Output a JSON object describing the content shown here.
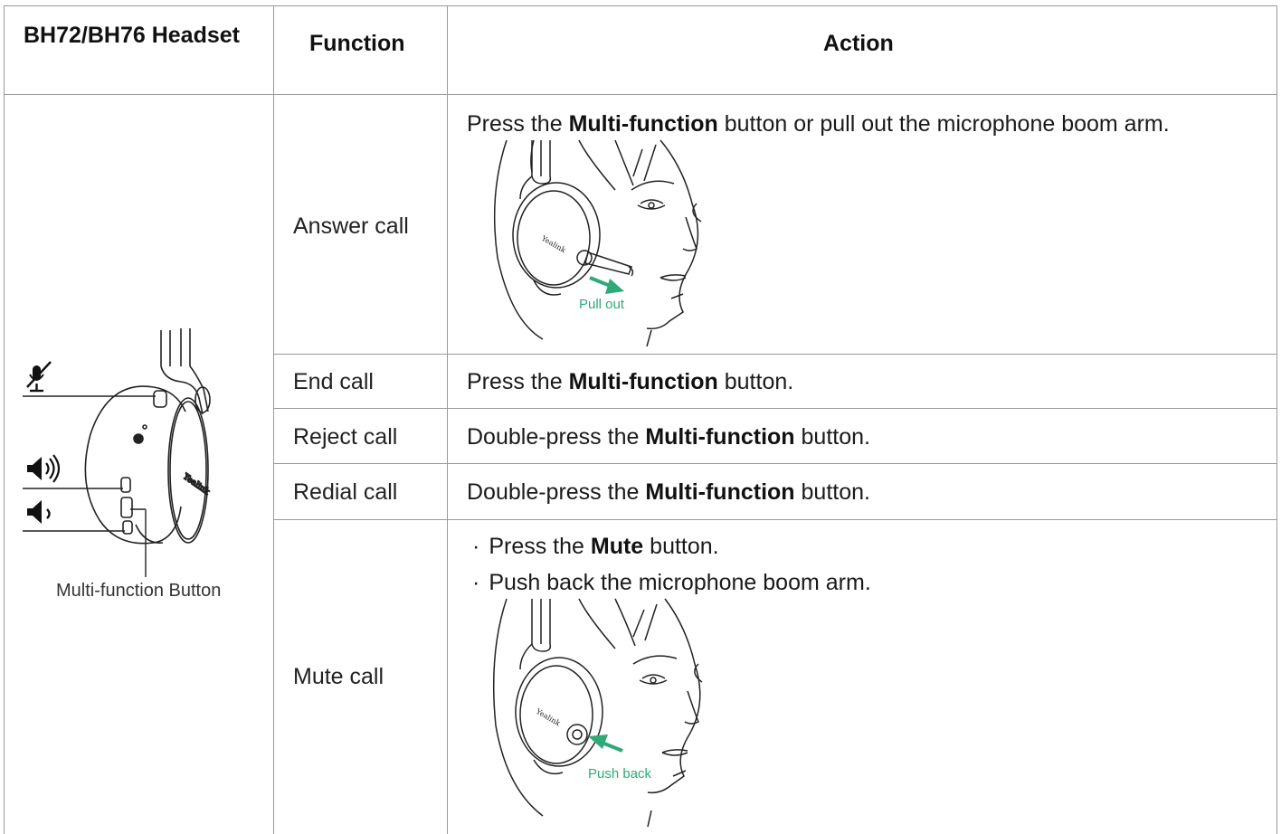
{
  "table": {
    "headers": {
      "headset": "BH72/BH76 Headset",
      "function": "Function",
      "action": "Action"
    },
    "headset_image": {
      "caption": "Multi-function Button",
      "icons": [
        "mic-mute-icon",
        "volume-up-icon",
        "volume-down-icon"
      ]
    },
    "rows": [
      {
        "function": "Answer call",
        "action": {
          "pre": "Press the ",
          "bold": "Multi-function",
          "post": " button or pull out the microphone boom arm."
        },
        "illustration_label": "Pull out"
      },
      {
        "function": "End call",
        "action": {
          "pre": "Press the ",
          "bold": "Multi-function",
          "post": " button."
        }
      },
      {
        "function": "Reject call",
        "action": {
          "pre": "Double-press the ",
          "bold": "Multi-function",
          "post": " button."
        }
      },
      {
        "function": "Redial call",
        "action": {
          "pre": "Double-press the ",
          "bold": "Multi-function",
          "post": " button."
        }
      },
      {
        "function": "Mute call",
        "bullets": [
          {
            "pre": "Press the ",
            "bold": "Mute",
            "post": " button."
          },
          {
            "pre": "Push back the microphone boom arm.",
            "bold": "",
            "post": ""
          }
        ],
        "bullet_char": "·",
        "illustration_label": "Push back"
      }
    ]
  },
  "colors": {
    "border": "#9a9a9a",
    "accent_green": "#2fa978",
    "text": "#1a1a1a"
  }
}
